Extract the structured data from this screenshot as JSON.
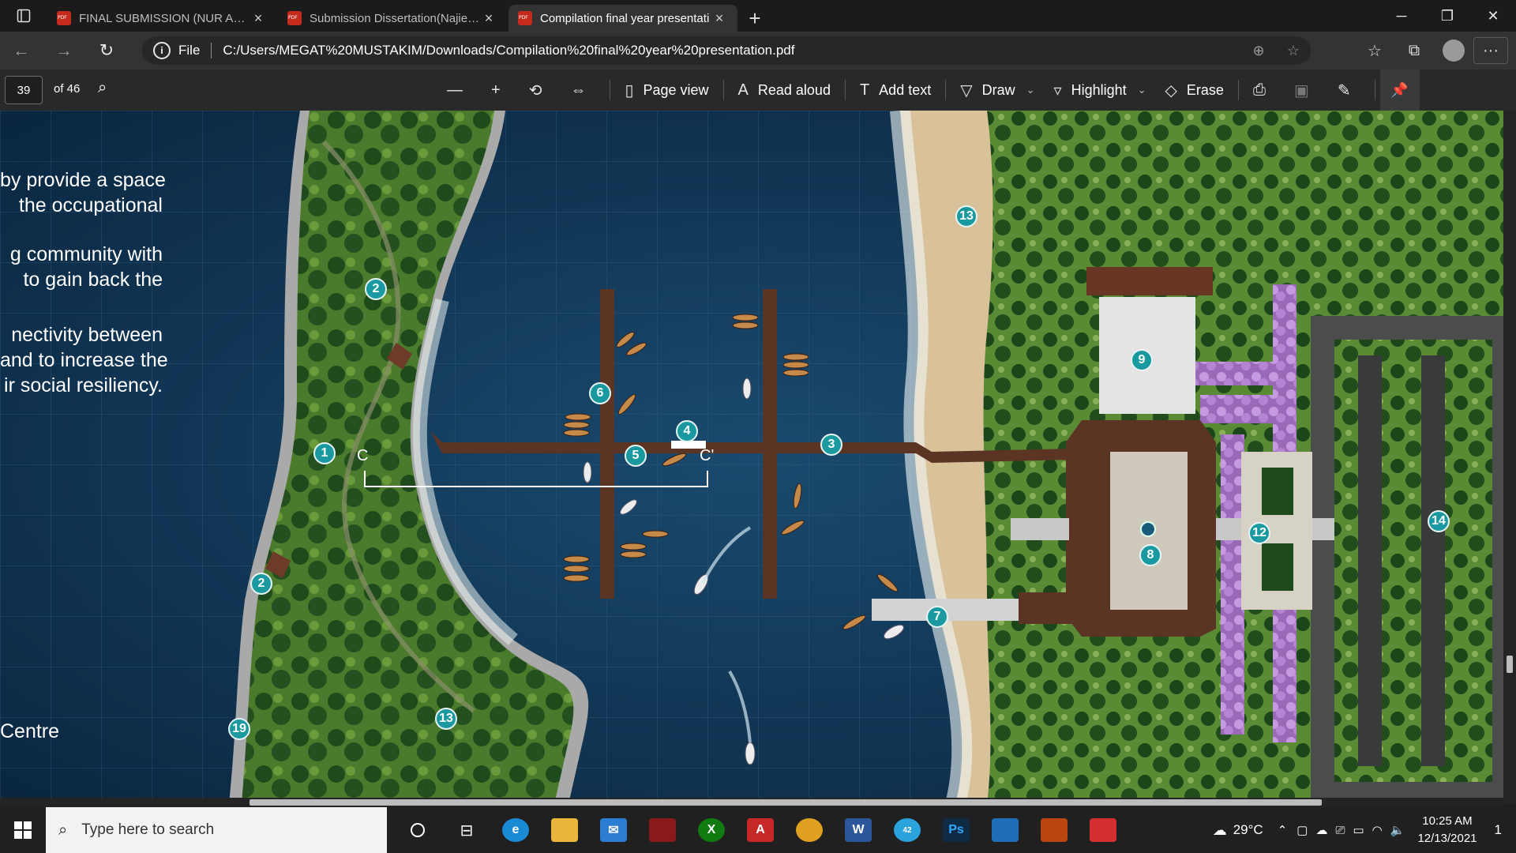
{
  "tabs": [
    {
      "label": "FINAL SUBMISSION (NUR ADIIBA",
      "active": false
    },
    {
      "label": "Submission Dissertation(Najiehah",
      "active": false
    },
    {
      "label": "Compilation final year presentati",
      "active": true
    }
  ],
  "address": {
    "scheme": "File",
    "url": "C:/Users/MEGAT%20MUSTAKIM/Downloads/Compilation%20final%20year%20presentation.pdf"
  },
  "pdf_toolbar": {
    "page_number": "39",
    "page_count": "of 46",
    "page_view": "Page view",
    "read_aloud": "Read aloud",
    "add_text": "Add text",
    "draw": "Draw",
    "highlight": "Highlight",
    "erase": "Erase"
  },
  "document": {
    "paragraphs": [
      {
        "line1": "by provide a space",
        "line2": "the occupational",
        "line3": ""
      },
      {
        "line1": "g community with",
        "line2": "to gain back the",
        "line3": ""
      },
      {
        "line1": "nectivity between",
        "line2": "and to increase the",
        "line3": "ir social resiliency."
      }
    ],
    "bottom_label": "Centre",
    "section_marker_left": "C",
    "section_marker_right": "C'",
    "markers": [
      "1",
      "2",
      "2",
      "3",
      "4",
      "5",
      "6",
      "7",
      "8",
      "9",
      "12",
      "13",
      "13",
      "14",
      "19"
    ]
  },
  "taskbar": {
    "search_placeholder": "Type here to search",
    "weather": "29°C",
    "time": "10:25 AM",
    "date": "12/13/2021",
    "telegram_badge": "42",
    "notification_count": "1"
  },
  "icons": {
    "back": "back-arrow-icon",
    "forward": "forward-arrow-icon",
    "refresh": "refresh-icon",
    "zoom": "zoom-icon",
    "favorites": "star-add-icon",
    "collections": "collections-icon",
    "profile": "profile-icon",
    "settings": "more-icon"
  },
  "colors": {
    "map_water": "#0f3450",
    "map_grass": "#4d7b2e",
    "marker_teal": "#1a9aa0",
    "deck_brown": "#5b3423",
    "accent_tab": "#333333"
  }
}
